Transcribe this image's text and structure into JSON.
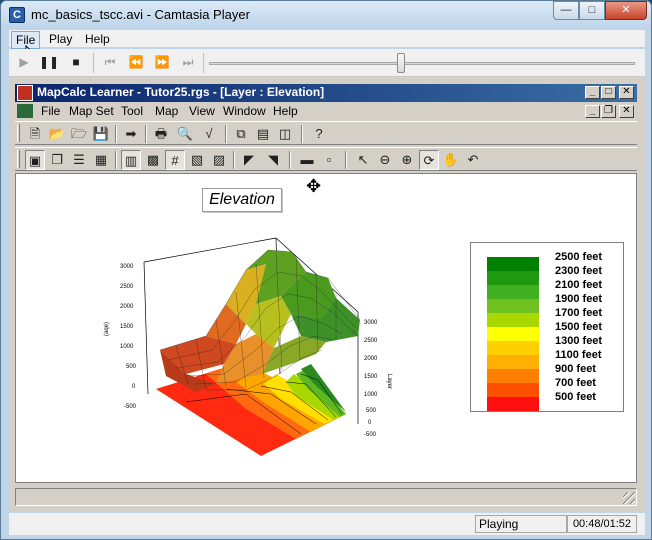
{
  "player": {
    "title": "mc_basics_tscc.avi - Camtasia Player",
    "menu": [
      "File",
      "Play",
      "Help"
    ],
    "status": "Playing",
    "time": "00:48/01:52",
    "seek_fraction": 0.45
  },
  "app": {
    "title": "MapCalc Learner - Tutor25.rgs - [Layer : Elevation]",
    "menu": [
      "File",
      "Map Set",
      "Tool",
      "Map",
      "View",
      "Window",
      "Help"
    ]
  },
  "map": {
    "title": "Elevation",
    "left_axis_ticks": [
      "3000",
      "2500",
      "2000",
      "1500",
      "1000",
      "500",
      "0",
      "-500"
    ],
    "left_axis_label": "(aqe)",
    "right_axis_ticks": [
      "3000",
      "2500",
      "2000",
      "1500",
      "1000",
      "500",
      "0",
      "-500"
    ],
    "right_axis_label": "Layer"
  },
  "legend": {
    "items": [
      {
        "label": "2500 feet",
        "color": "#008000"
      },
      {
        "label": "2300 feet",
        "color": "#1f9a10"
      },
      {
        "label": "2100 feet",
        "color": "#40b020"
      },
      {
        "label": "1900 feet",
        "color": "#70c020"
      },
      {
        "label": "1700 feet",
        "color": "#a8d800"
      },
      {
        "label": "1500 feet",
        "color": "#ffff00"
      },
      {
        "label": "1300 feet",
        "color": "#ffd000"
      },
      {
        "label": "1100 feet",
        "color": "#ffb000"
      },
      {
        "label": "900 feet",
        "color": "#ff8000"
      },
      {
        "label": "700 feet",
        "color": "#ff5000"
      },
      {
        "label": "500 feet",
        "color": "#ff1010"
      }
    ]
  }
}
